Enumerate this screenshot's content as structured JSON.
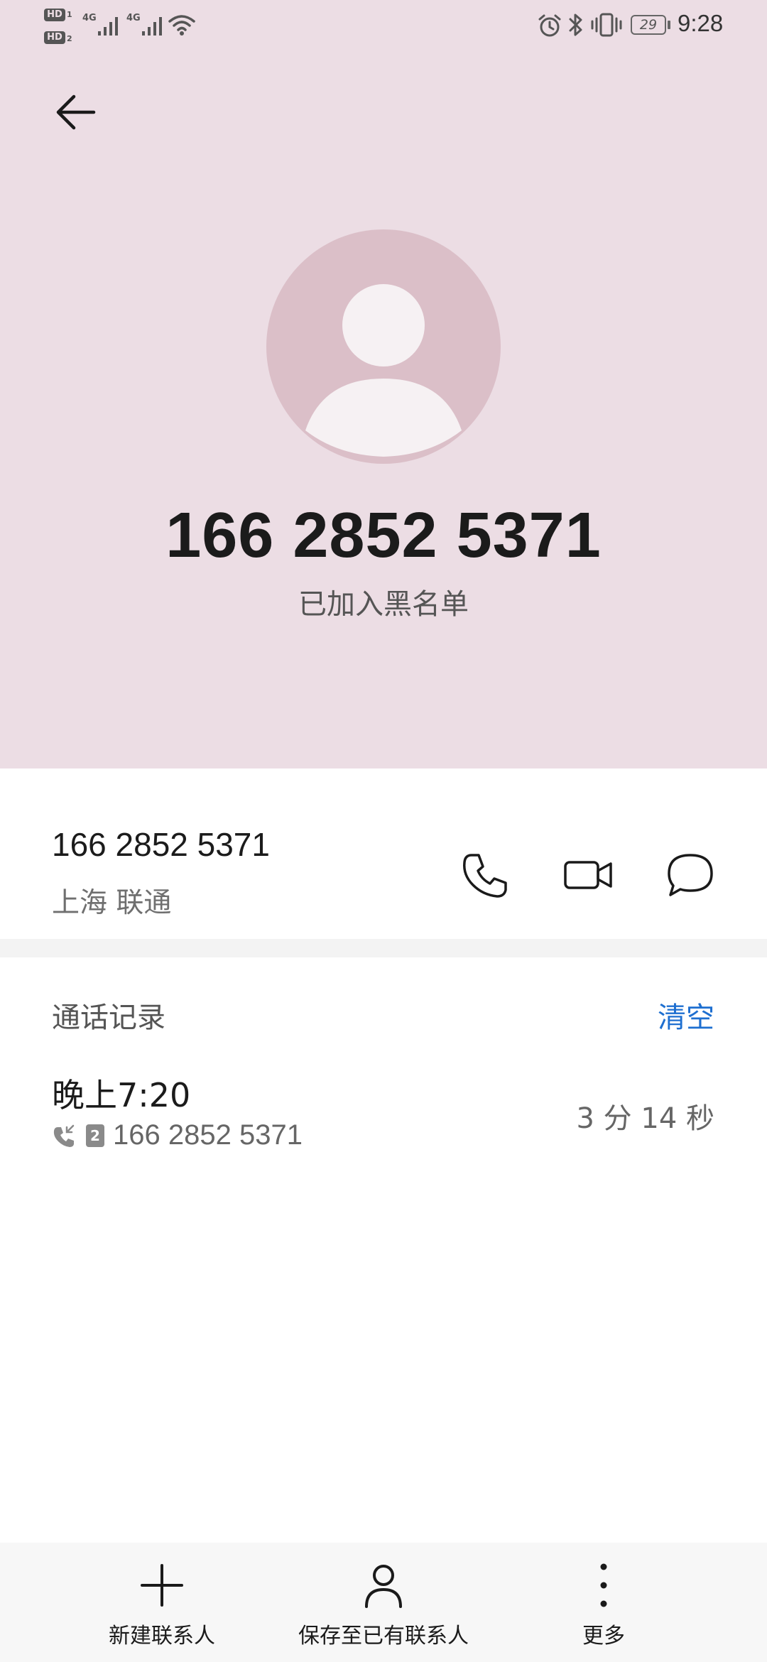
{
  "status_bar": {
    "hd1": "HD",
    "hd1_sim": "1",
    "hd2": "HD",
    "hd2_sim": "2",
    "net1": "4G",
    "net2": "4G",
    "battery": "29",
    "time": "9:28",
    "icons": [
      "alarm-icon",
      "bluetooth-icon",
      "vibrate-icon",
      "battery-icon",
      "wifi-icon",
      "signal-icon"
    ]
  },
  "header": {
    "back_icon": "arrow-left-icon",
    "avatar_icon": "person-icon",
    "number": "166 2852 5371",
    "status": "已加入黑名单",
    "background": "#ecdde4"
  },
  "number_section": {
    "number": "166 2852 5371",
    "carrier": "上海 联通",
    "actions": [
      "phone-icon",
      "video-call-icon",
      "message-icon"
    ]
  },
  "call_log": {
    "title": "通话记录",
    "clear_label": "清空",
    "clear_color": "#1e6fd0",
    "entries": [
      {
        "time": "晚上7:20",
        "sim": "2",
        "number": "166 2852 5371",
        "duration": "3 分 14 秒",
        "type_icon": "incoming-call-icon"
      }
    ]
  },
  "bottom_bar": {
    "items": [
      {
        "label": "新建联系人",
        "icon": "plus-icon"
      },
      {
        "label": "保存至已有联系人",
        "icon": "person-outline-icon"
      },
      {
        "label": "更多",
        "icon": "more-vertical-icon"
      }
    ]
  }
}
